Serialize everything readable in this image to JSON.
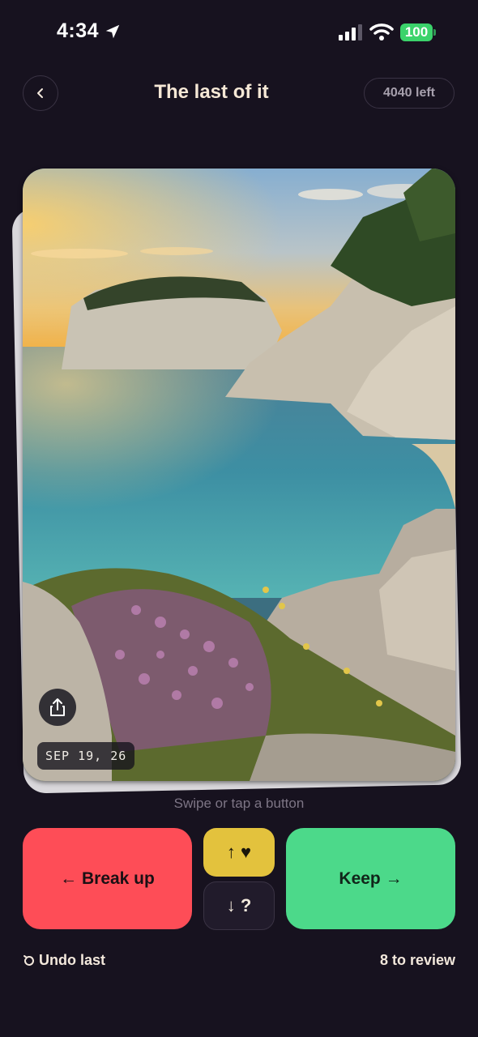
{
  "status_bar": {
    "time": "4:34",
    "battery": "100",
    "icons": [
      "location-arrow-icon",
      "cellular-signal-icon",
      "wifi-icon",
      "battery-icon"
    ]
  },
  "header": {
    "back_icon": "chevron-left-icon",
    "title": "The last of it",
    "remaining": "4040 left"
  },
  "photo": {
    "subject": "coastal cove at sunset",
    "date": "SEP 19, 26",
    "share_icon": "share-icon"
  },
  "hint": "Swipe or tap a button",
  "actions": {
    "break_up": "← Break up",
    "keep": "Keep →",
    "favorite": "↑ ♥",
    "unsure": "↓ ?"
  },
  "footer": {
    "undo": "Undo last",
    "undo_icon": "undo-icon",
    "to_review": "8 to review"
  },
  "colors": {
    "background": "#17121f",
    "break_up": "#fe4d57",
    "keep": "#4cd98a",
    "favorite": "#e3c23d"
  }
}
